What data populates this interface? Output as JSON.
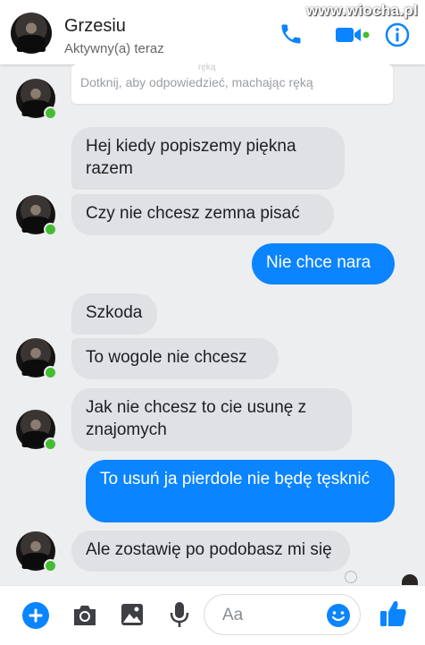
{
  "header": {
    "name": "Grzesiu",
    "status": "Aktywny(a) teraz",
    "watermark": "www.wiocha.pl",
    "icons": [
      "phone-icon",
      "video-icon",
      "info-icon"
    ],
    "accent_color": "#0b84ff"
  },
  "hint": {
    "faded_text": "ręką",
    "text": "Dotknij, aby odpowiedzieć, machając ręką"
  },
  "messages": [
    {
      "direction": "in",
      "text": "Hej kiedy popiszemy piękna razem"
    },
    {
      "direction": "in",
      "text": "Czy nie chcesz zemna pisać"
    },
    {
      "direction": "out",
      "text": "Nie chce nara"
    },
    {
      "direction": "in",
      "text": "Szkoda"
    },
    {
      "direction": "in",
      "text": "To wogole nie chcesz"
    },
    {
      "direction": "in",
      "text": "Jak nie chcesz to cie usunę z znajomych"
    },
    {
      "direction": "out",
      "text": "To usuń ja pierdole nie będę tęsknić"
    },
    {
      "direction": "in",
      "text": "Ale zostawię po podobasz mi się"
    }
  ],
  "composer": {
    "placeholder": "Aa",
    "icons": [
      "plus-icon",
      "camera-icon",
      "image-icon",
      "microphone-icon",
      "emoji-icon",
      "like-icon"
    ]
  },
  "colors": {
    "incoming_bubble": "#dfe1e4",
    "outgoing_bubble": "#0b84ff",
    "online": "#44bd32"
  }
}
